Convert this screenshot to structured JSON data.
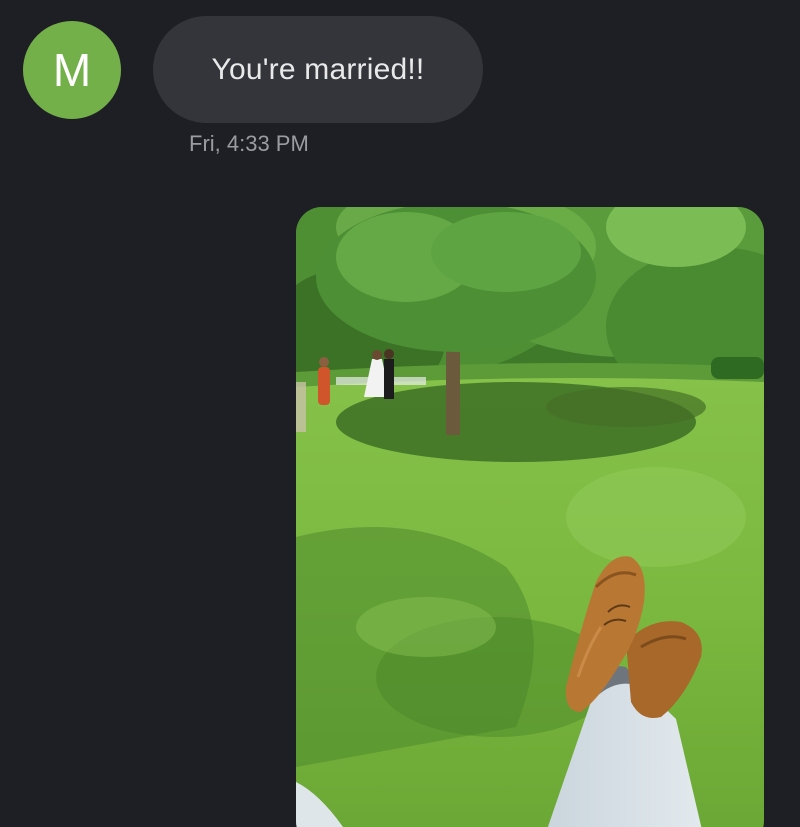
{
  "conversation": {
    "incoming_message": {
      "avatar_initial": "M",
      "avatar_color": "#74b04a",
      "text": "You're married!!",
      "bubble_color": "#33353a",
      "timestamp": "Fri, 4:33 PM"
    },
    "attachment": {
      "type": "photo",
      "icon": "image-attachment"
    }
  },
  "colors": {
    "background": "#1e1f24",
    "text_primary": "#e9e9ea",
    "text_secondary": "#9b9ca1"
  }
}
